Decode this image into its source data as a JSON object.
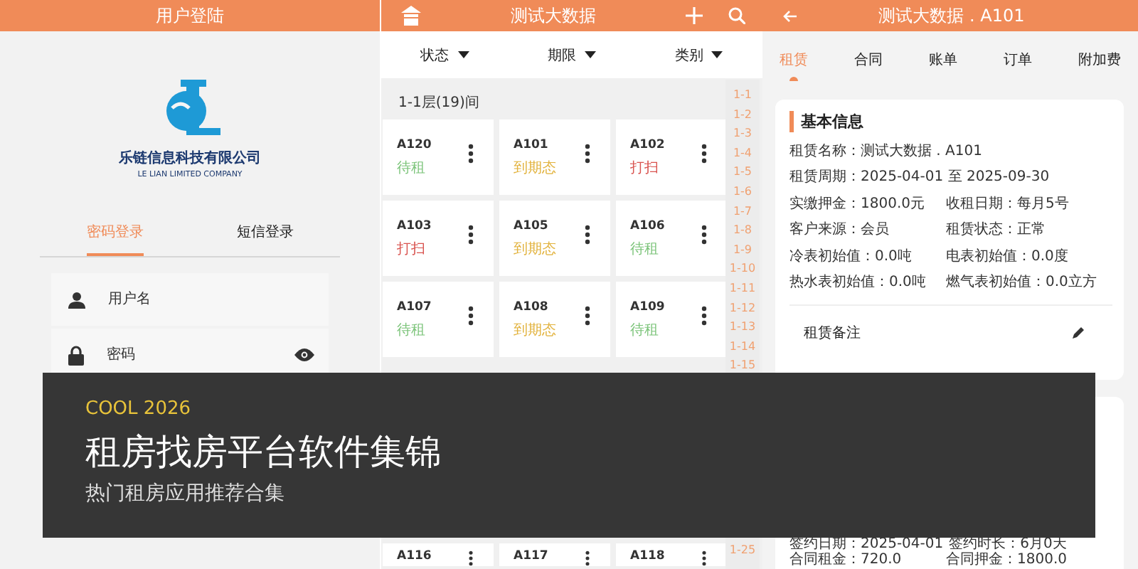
{
  "login_screen": {
    "title": "用户登陆",
    "company_name": "乐链信息科技有限公司",
    "company_name_en": "LE LIAN LIMITED COMPANY",
    "tabs": [
      {
        "label": "密码登录",
        "selected": true
      },
      {
        "label": "短信登录",
        "selected": false
      }
    ],
    "fields": [
      {
        "kind": "user",
        "placeholder": "用户名"
      },
      {
        "kind": "password",
        "placeholder": "密码"
      }
    ]
  },
  "rooms_screen": {
    "title": "测试大数据",
    "filters": [
      "状态",
      "期限",
      "类别"
    ],
    "floor_header": "1-1层(19)间",
    "rooms": [
      {
        "name": "A120",
        "status": "待租",
        "color": "#7cc47a"
      },
      {
        "name": "A101",
        "status": "到期态",
        "color": "#e2b23c"
      },
      {
        "name": "A102",
        "status": "打扫",
        "color": "#d9534f"
      },
      {
        "name": "A103",
        "status": "打扫",
        "color": "#d9534f"
      },
      {
        "name": "A105",
        "status": "到期态",
        "color": "#e2b23c"
      },
      {
        "name": "A106",
        "status": "待租",
        "color": "#7cc47a"
      },
      {
        "name": "A107",
        "status": "待租",
        "color": "#7cc47a"
      },
      {
        "name": "A108",
        "status": "到期态",
        "color": "#e2b23c"
      },
      {
        "name": "A109",
        "status": "待租",
        "color": "#7cc47a"
      }
    ],
    "rooms_lower": [
      {
        "name": "A116"
      },
      {
        "name": "A117"
      },
      {
        "name": "A118"
      }
    ],
    "index_upper": [
      "1-1",
      "1-2",
      "1-3",
      "1-4",
      "1-5",
      "1-6",
      "1-7",
      "1-8",
      "1-9",
      "1-10",
      "1-11",
      "1-12",
      "1-13",
      "1-14",
      "1-15"
    ],
    "index_lower": [
      "1-25"
    ]
  },
  "detail_screen": {
    "title": "测试大数据 . A101",
    "tabs": [
      {
        "label": "租赁",
        "selected": true
      },
      {
        "label": "合同",
        "selected": false
      },
      {
        "label": "账单",
        "selected": false
      },
      {
        "label": "订单",
        "selected": false
      },
      {
        "label": "附加费",
        "selected": false
      }
    ],
    "basic_info": {
      "title": "基本信息",
      "rows": [
        [
          "租赁名称：测试大数据 . A101"
        ],
        [
          "租赁周期：2025-04-01 至 2025-09-30"
        ],
        [
          "实缴押金：1800.0元",
          "收租日期：每月5号"
        ],
        [
          "客户来源：会员",
          "租赁状态：正常"
        ],
        [
          "冷表初始值：0.0吨",
          "电表初始值：0.0度"
        ],
        [
          "热水表初始值：0.0吨",
          "燃气表初始值：0.0立方"
        ]
      ],
      "remark_label": "租赁备注"
    },
    "contract_rows": [
      [
        "签约日期：2025-04-01",
        "签约时长：6月0天"
      ],
      [
        "合同租金：720.0",
        "合同押金：1800.0"
      ]
    ]
  },
  "banner": {
    "tag": "COOL 2026",
    "title": "租房找房平台软件集锦",
    "subtitle": "热门租房应用推荐合集"
  }
}
